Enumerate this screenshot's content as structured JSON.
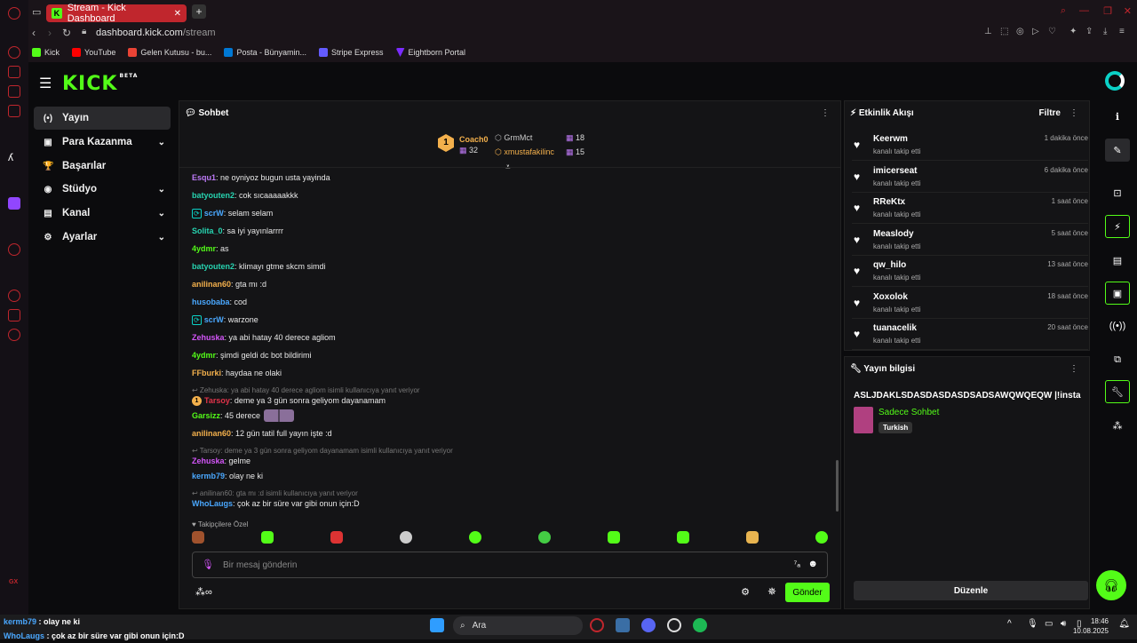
{
  "browser": {
    "tab_title": "Stream - Kick Dashboard",
    "url_host": "dashboard.kick.com",
    "url_path": "/stream",
    "bookmarks": [
      "Kick",
      "YouTube",
      "Gelen Kutusu - bu...",
      "Posta - Bünyamin...",
      "Stripe Express",
      "Eightborn Portal"
    ],
    "opera_gx_label": "GX"
  },
  "app": {
    "logo": "KICK",
    "beta": "BETA"
  },
  "nav": {
    "items": [
      {
        "label": "Yayın",
        "icon": "(•)"
      },
      {
        "label": "Para Kazanma",
        "icon": "▣"
      },
      {
        "label": "Başarılar",
        "icon": "🏆"
      },
      {
        "label": "Stüdyo",
        "icon": "◉"
      },
      {
        "label": "Kanal",
        "icon": "▤"
      },
      {
        "label": "Ayarlar",
        "icon": "⚙"
      }
    ]
  },
  "chat": {
    "title": "Sohbet",
    "leaders": {
      "first_name": "Coach0",
      "first_count": "32",
      "rank": "1",
      "second_name": "GrmMct",
      "second_count": "18",
      "third_name": "xmustafakilinc",
      "third_count": "15"
    },
    "lines": [
      {
        "user": "Esqu1",
        "text": "ne oyniyoz bugun usta yayinda",
        "color": "#bd7af7"
      },
      {
        "user": "batyouten2",
        "text": "cok sıcaaaaakkk",
        "color": "#27d3b0"
      },
      {
        "user": "scrW",
        "text": "selam selam",
        "color": "#4aa8ff",
        "badge": true
      },
      {
        "user": "Solita_0",
        "text": "sa iyi yayınlarrrr",
        "color": "#27d3b0"
      },
      {
        "user": "4ydmr",
        "text": "as",
        "color": "#53fc18"
      },
      {
        "user": "batyouten2",
        "text": "klimayı gtme skcm simdi",
        "color": "#27d3b0"
      },
      {
        "user": "anilinan60",
        "text": "gta mı :d",
        "color": "#f3b04c"
      },
      {
        "user": "husobaba",
        "text": "cod",
        "color": "#4aa8ff"
      },
      {
        "user": "scrW",
        "text": "warzone",
        "color": "#4aa8ff",
        "badge": true
      },
      {
        "user": "Zehuska",
        "text": "ya abi hatay 40 derece agliom",
        "color": "#d255f7"
      },
      {
        "user": "4ydmr",
        "text": "şimdi geldi dc bot bildirimi",
        "color": "#53fc18"
      },
      {
        "user": "FFburki",
        "text": "haydaa ne olaki",
        "color": "#f3b04c"
      }
    ],
    "reply1": "Zehuska: ya abi hatay 40 derece agliom isimli kullanıcıya yanıt veriyor",
    "line_tarsoy": {
      "user": "Tarsoy",
      "text": "deme ya 3 gün sonra geliyom dayanamam"
    },
    "line_garsizz": {
      "user": "Garsizz",
      "text": "45 derece"
    },
    "line_anilinan2": {
      "user": "anilinan60",
      "text": "12 gün tatil full yayın işte :d"
    },
    "reply2": "Tarsoy: deme ya 3 gün sonra geliyom dayanamam isimli kullanıcıya yanıt veriyor",
    "line_zehuska2": {
      "user": "Zehuska",
      "text": "gelme"
    },
    "line_kermb": {
      "user": "kermb79",
      "text": "olay ne ki"
    },
    "reply3": "anilinan60: gta mı :d isimli kullanıcıya yanıt veriyor",
    "line_wholaugs": {
      "user": "WhoLaugs",
      "text": "çok az bir süre var gibi onun için:D"
    },
    "followers_only": "Takipçilere Özel",
    "input_placeholder": "Bir mesaj gönderin",
    "send_label": "Gönder"
  },
  "activity": {
    "title": "Etkinlik Akışı",
    "filter_label": "Filtre",
    "items": [
      {
        "name": "Keerwm",
        "sub": "kanalı takip etti",
        "time": "1 dakika önce"
      },
      {
        "name": "imicerseat",
        "sub": "kanalı takip etti",
        "time": "6 dakika önce"
      },
      {
        "name": "RReKtx",
        "sub": "kanalı takip etti",
        "time": "1 saat önce"
      },
      {
        "name": "Measlody",
        "sub": "kanalı takip etti",
        "time": "5 saat önce"
      },
      {
        "name": "qw_hilo",
        "sub": "kanalı takip etti",
        "time": "13 saat önce"
      },
      {
        "name": "Xoxolok",
        "sub": "kanalı takip etti",
        "time": "18 saat önce"
      },
      {
        "name": "tuanacelik",
        "sub": "kanalı takip etti",
        "time": "20 saat önce"
      }
    ]
  },
  "stream_info": {
    "title": "Yayın bilgisi",
    "stream_title": "ASLJDAKLSDASDASDASDSADSAWQWQEQW |!insta",
    "category": "Sadece Sohbet",
    "language": "Turkish",
    "edit_label": "Düzenle"
  },
  "taskbar": {
    "search_label": "Ara",
    "time": "18:46",
    "date": "10.08.2025",
    "overlay_line1_user": "kermb79",
    "overlay_line1_text": " : olay ne ki",
    "overlay_line2_user": "WhoLaugs",
    "overlay_line2_text": " : çok az bir süre var gibi onun için:D"
  }
}
